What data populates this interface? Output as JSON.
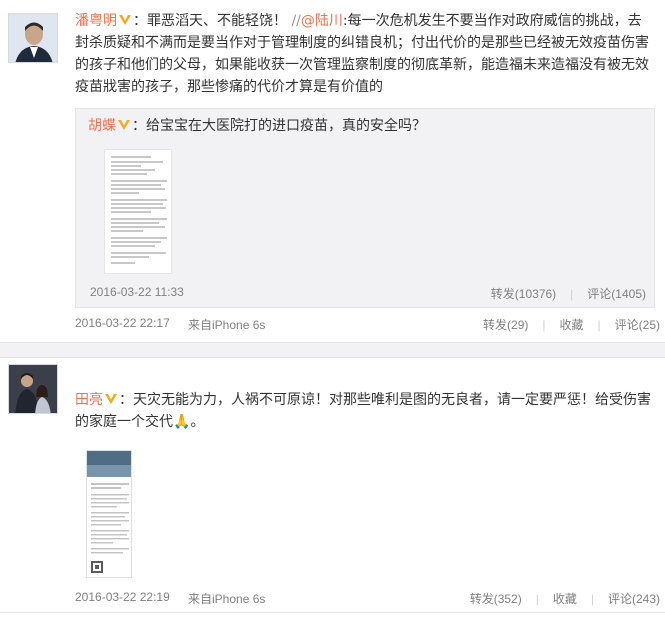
{
  "posts": [
    {
      "author": "潘粤明",
      "text_main": "：罪恶滔天、不能轻饶！",
      "repost_marker": "//",
      "mention": "@陆川",
      "text_rest": ":每一次危机发生不要当作对政府威信的挑战，去封杀质疑和不满而是要当作对于管理制度的纠错良机；付出代价的是那些已经被无效疫苗伤害的孩子和他们的父母，如果能收获一次管理监察制度的彻底革新，能造福未来造福没有被无效疫苗戕害的孩子，那些惨痛的代价才算是有价值的",
      "quoted": {
        "author": "胡蝶",
        "text": "：给宝宝在大医院打的进口疫苗，真的安全吗？",
        "time": "2016-03-22 11:33",
        "repost": "转发(10376)",
        "comment": "评论(1405)"
      },
      "time": "2016-03-22 22:17",
      "source": "来自iPhone 6s",
      "repost": "转发(29)",
      "favorite": "收藏",
      "comment": "评论(25)"
    },
    {
      "author": "田亮",
      "text_main": "：天灾无能为力，人祸不可原谅！对那些唯利是图的无良者，请一定要严惩！给受伤害的家庭一个交代",
      "emoji": "🙏",
      "text_end": "。",
      "time": "2016-03-22 22:19",
      "source": "来自iPhone 6s",
      "repost": "转发(352)",
      "favorite": "收藏",
      "comment": "评论(243)"
    }
  ],
  "colors": {
    "accent": "#eb7350",
    "verified_badge": "#f5a623",
    "meta_text": "#808080",
    "quote_bg": "#f2f2f5"
  },
  "icons": [
    "verified-v-icon",
    "avatar"
  ]
}
